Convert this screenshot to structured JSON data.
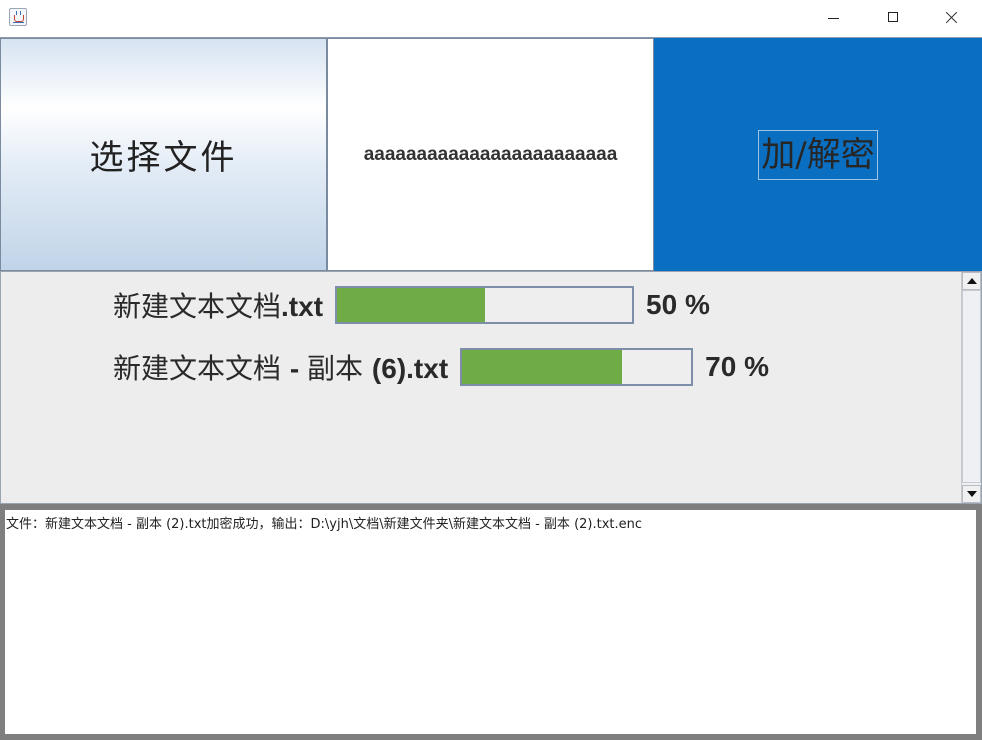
{
  "window": {
    "icon": "java-coffee-icon",
    "controls": [
      "minimize-icon",
      "maximize-icon",
      "close-icon"
    ]
  },
  "toolbar": {
    "choose_file_label": "选择文件",
    "selected_filename": "aaaaaaaaaaaaaaaaaaaaaaaa",
    "crypt_label": "加/解密"
  },
  "progress": {
    "items": [
      {
        "name_cn": "新建文本文档",
        "name_suffix": ".txt",
        "percent": 50,
        "percent_text": "50 %"
      },
      {
        "name_cn": "新建文本文档 ",
        "name_mid": "- ",
        "name_cn2": "副本 ",
        "name_suffix": "(6).txt",
        "percent": 70,
        "percent_text": "70 %"
      }
    ],
    "fill_color": "#6fac46"
  },
  "log": {
    "text": "文件：新建文本文档 - 副本 (2).txt加密成功，输出：D:\\yjh\\文档\\新建文件夹\\新建文本文档 - 副本 (2).txt.enc"
  },
  "colors": {
    "crypt_button": "#0a6fc1",
    "panel_bg": "#ededed"
  }
}
